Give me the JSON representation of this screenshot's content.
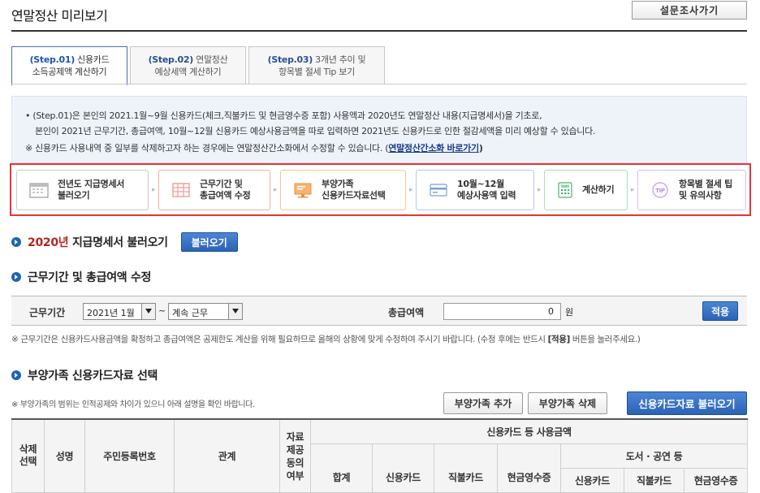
{
  "page": {
    "title": "연말정산 미리보기",
    "survey_button": "설문조사가기"
  },
  "tabs": [
    {
      "step": "(Step.01)",
      "line1": "신용카드",
      "line2": "소득공제액 계산하기"
    },
    {
      "step": "(Step.02)",
      "line1": "연말정산",
      "line2": "예상세액 계산하기"
    },
    {
      "step": "(Step.03)",
      "line1": "3개년 추이 및",
      "line2": "항목별 절세 Tip 보기"
    }
  ],
  "info": {
    "line1": "• (Step.01)은 본인의 2021.1월~9월 신용카드(체크,직불카드 및 현금영수증 포함) 사용액과 2020년도 연말정산 내용(지급명세서)을 기초로,",
    "line2": "본인이 2021년 근무기간, 총급여액, 10월~12월 신용카드 예상사용금액을 따로 입력하면 2021년도 신용카드로 인한 절감세액을 미리 예상할 수 있습니다.",
    "line3": "※ 신용카드 사용내역 중 일부를 삭제하고자 하는 경우에는 연말정산간소화에서 수정할 수 있습니다. (",
    "link": "연말정산간소화 바로가기",
    "line3_end": ")"
  },
  "steps": [
    {
      "line1": "전년도 지급명세서",
      "line2": "불러오기",
      "icon": "calendar-icon",
      "color": "#9a9a9a"
    },
    {
      "line1": "근무기간 및",
      "line2": "총급여액 수정",
      "icon": "grid-icon",
      "color": "#e88b86"
    },
    {
      "line1": "부양가족",
      "line2": "신용카드자료선택",
      "icon": "monitor-icon",
      "color": "#f0a050"
    },
    {
      "line1": "10월~12월",
      "line2": "예상사용액 입력",
      "icon": "card-icon",
      "color": "#7aa0d8"
    },
    {
      "line1": "계산하기",
      "line2": "",
      "icon": "calculator-icon",
      "color": "#6bbf8c"
    },
    {
      "line1": "항목별 절세 팁",
      "line2": "및 유의사항",
      "icon": "tip-icon",
      "color": "#b58fd8"
    }
  ],
  "section1": {
    "year": "2020년",
    "title": "지급명세서 불러오기",
    "button": "불러오기"
  },
  "section2": {
    "title": "근무기간 및 총급여액 수정",
    "period_label": "근무기간",
    "period_start": "2021년 1월",
    "tilde": "~",
    "period_end": "계속 근무",
    "salary_label": "총급여액",
    "salary_value": "0",
    "won": "원",
    "apply_button": "적용",
    "note_before": "※ 근무기간은 신용카드사용금액을 확정하고 총급여액은 공제한도 계산을 위해 필요하므로 올해의 상황에 맞게 수정하여 주시기 바랍니다. (수정 후에는 반드시 ",
    "note_bold": "[적용]",
    "note_after": " 버튼을 눌러주세요.)"
  },
  "section3": {
    "title": "부양가족 신용카드자료 선택",
    "note": "※ 부양가족의 범위는 인적공제와 차이가 있으니 아래 설명을 확인 바랍니다.",
    "add_button": "부양가족 추가",
    "delete_button": "부양가족 삭제",
    "load_button": "신용카드자료 불러오기"
  },
  "table": {
    "col_delete": "삭제선택",
    "col_name": "성명",
    "col_rrn": "주민등록번호",
    "col_relation": "관계",
    "col_consent": "자료제공동의여부",
    "group_usage": "신용카드 등 사용금액",
    "col_total": "합계",
    "col_credit": "신용카드",
    "col_debit": "직불카드",
    "col_cash": "현금영수증",
    "group_culture": "도서 · 공연 등",
    "sub_credit": "신용카드",
    "sub_debit": "직불카드",
    "sub_cash": "현금영수증"
  }
}
